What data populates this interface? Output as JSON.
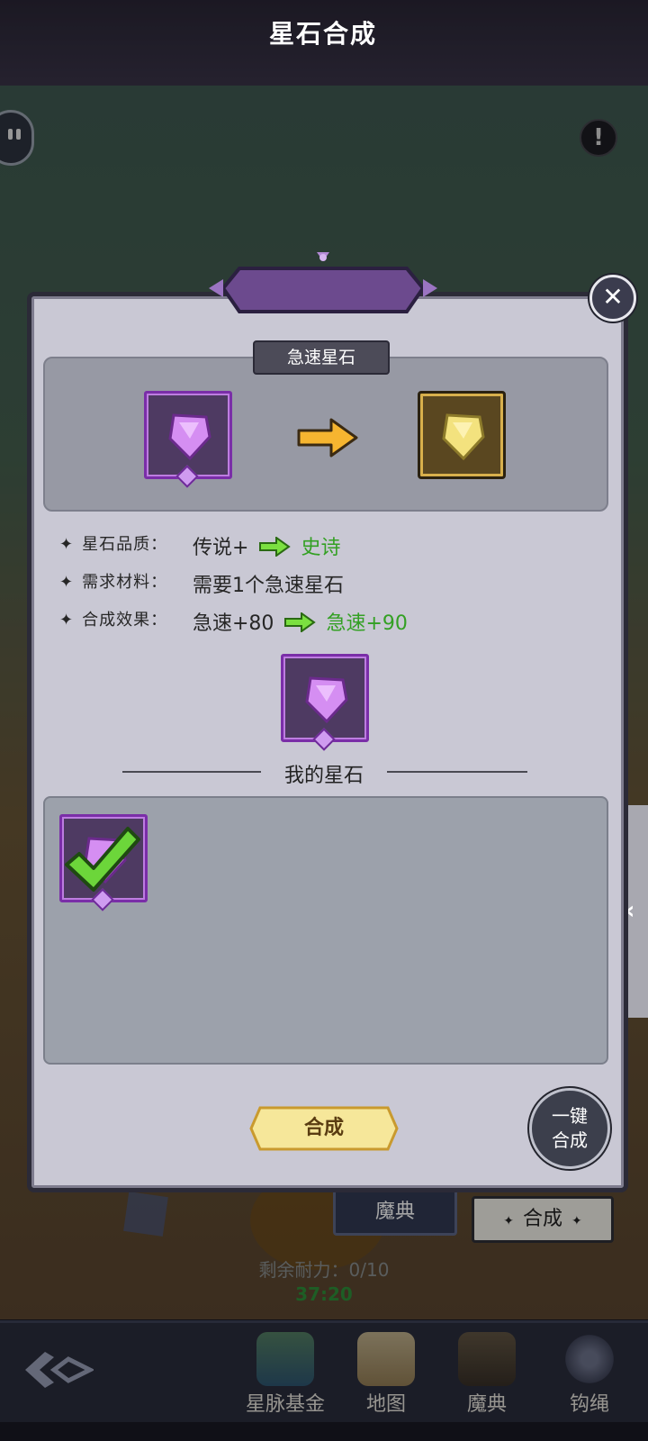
{
  "panel": {
    "title": "星石合成",
    "close_glyph": "✕",
    "subtitle": "急速星石"
  },
  "info_rows": [
    {
      "label": "星石品质：",
      "from": "传说+",
      "to": "史诗"
    },
    {
      "label": "需求材料：",
      "text": "需要1个急速星石"
    },
    {
      "label": "合成效果：",
      "from": "急速+80",
      "to": "急速+90"
    }
  ],
  "inventory": {
    "header": "我的星石"
  },
  "buttons": {
    "synthesize": "合成",
    "one_key_line1": "一键",
    "one_key_line2": "合成"
  },
  "behind": {
    "tab_magic": "魔典",
    "tab_synth": "合成",
    "durability": "剩余耐力：0/10",
    "timer": "37:20"
  },
  "nav": {
    "items": [
      "星脉基金",
      "地图",
      "魔典",
      "钩绳"
    ]
  },
  "icons": {
    "source_gem": "purple-gem-icon",
    "result_gem": "yellow-gem-icon",
    "arrow": "arrow-right-icon",
    "check": "checkmark-icon",
    "side_tab": "chevron-left-icon"
  },
  "colors": {
    "panel_bg": "#c9c8d4",
    "accent_green": "#33a023",
    "purple_frame": "#7a2ea8",
    "gold_frame": "#d8b04c"
  }
}
